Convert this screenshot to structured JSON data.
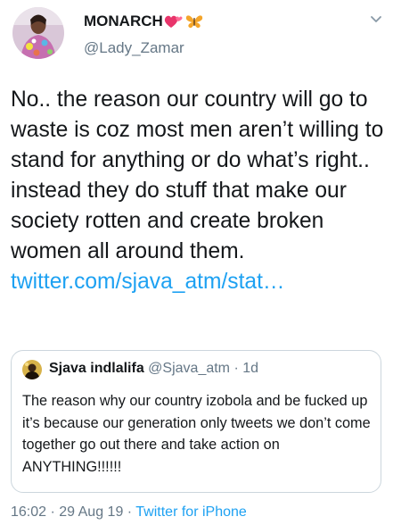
{
  "author": {
    "display_name": "MONARCH",
    "name_emojis": [
      "heart-icon",
      "butterfly-icon"
    ],
    "handle": "@Lady_Zamar"
  },
  "tweet": {
    "text": "No.. the reason our country will go to waste is coz most men aren’t willing to stand for anything or do what’s right.. instead they do stuff that make our society rotten and create broken women all around them. ",
    "link": "twitter.com/sjava_atm/stat…"
  },
  "quoted_tweet": {
    "name": "Sjava indlalifa",
    "handle": "@Sjava_atm",
    "separator": " · ",
    "time": "1d",
    "text": "The reason why our country izobola and be fucked up it’s because our generation only tweets we don’t come together go out there and take action on ANYTHING!!!!!!"
  },
  "meta": {
    "time": "16:02",
    "date": "29 Aug 19",
    "separator": " · ",
    "source": "Twitter for iPhone"
  },
  "colors": {
    "text": "#14171a",
    "secondary": "#657786",
    "link": "#1da1f2",
    "border": "#ccd6dd"
  }
}
